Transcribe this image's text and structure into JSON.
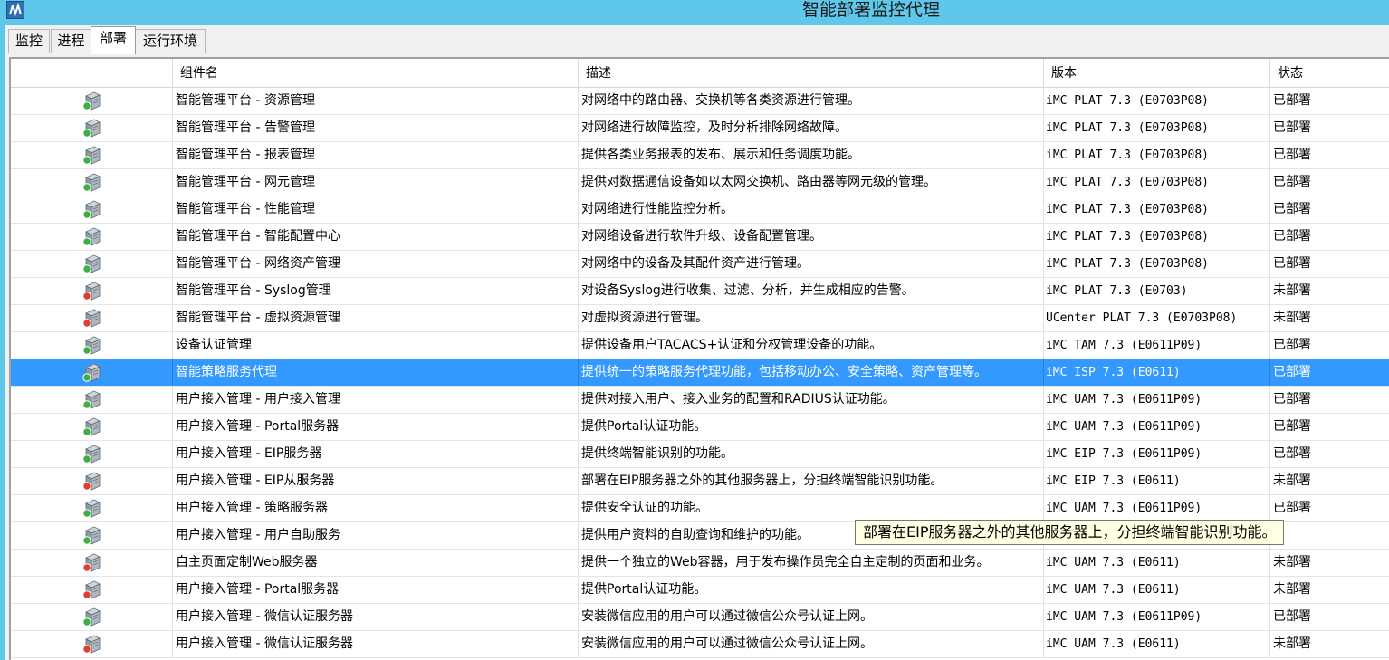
{
  "window": {
    "title": "智能部署监控代理",
    "app_icon": "imc-logo-icon"
  },
  "tabs": [
    {
      "label": "监控",
      "active": false
    },
    {
      "label": "进程",
      "active": false
    },
    {
      "label": "部署",
      "active": true
    },
    {
      "label": "运行环境",
      "active": false
    }
  ],
  "table": {
    "columns": [
      "",
      "组件名",
      "描述",
      "版本",
      "状态"
    ],
    "rows": [
      {
        "status_icon": "deployed-server-icon",
        "name": "智能管理平台 - 资源管理",
        "desc": "对网络中的路由器、交换机等各类资源进行管理。",
        "version": "iMC PLAT 7.3 (E0703P08)",
        "status": "已部署"
      },
      {
        "status_icon": "deployed-server-icon",
        "name": "智能管理平台 - 告警管理",
        "desc": "对网络进行故障监控，及时分析排除网络故障。",
        "version": "iMC PLAT 7.3 (E0703P08)",
        "status": "已部署"
      },
      {
        "status_icon": "deployed-server-icon",
        "name": "智能管理平台 - 报表管理",
        "desc": "提供各类业务报表的发布、展示和任务调度功能。",
        "version": "iMC PLAT 7.3 (E0703P08)",
        "status": "已部署"
      },
      {
        "status_icon": "deployed-server-icon",
        "name": "智能管理平台 - 网元管理",
        "desc": "提供对数据通信设备如以太网交换机、路由器等网元级的管理。",
        "version": "iMC PLAT 7.3 (E0703P08)",
        "status": "已部署"
      },
      {
        "status_icon": "deployed-server-icon",
        "name": "智能管理平台 - 性能管理",
        "desc": "对网络进行性能监控分析。",
        "version": "iMC PLAT 7.3 (E0703P08)",
        "status": "已部署"
      },
      {
        "status_icon": "deployed-server-icon",
        "name": "智能管理平台 - 智能配置中心",
        "desc": "对网络设备进行软件升级、设备配置管理。",
        "version": "iMC PLAT 7.3 (E0703P08)",
        "status": "已部署"
      },
      {
        "status_icon": "deployed-server-icon",
        "name": "智能管理平台 - 网络资产管理",
        "desc": "对网络中的设备及其配件资产进行管理。",
        "version": "iMC PLAT 7.3 (E0703P08)",
        "status": "已部署"
      },
      {
        "status_icon": "undeployed-server-icon",
        "name": "智能管理平台 - Syslog管理",
        "desc": "对设备Syslog进行收集、过滤、分析，并生成相应的告警。",
        "version": "iMC PLAT 7.3 (E0703)",
        "status": "未部署"
      },
      {
        "status_icon": "undeployed-server-icon",
        "name": "智能管理平台 - 虚拟资源管理",
        "desc": "对虚拟资源进行管理。",
        "version": "UCenter PLAT 7.3 (E0703P08)",
        "status": "未部署"
      },
      {
        "status_icon": "deployed-server-icon",
        "name": "设备认证管理",
        "desc": "提供设备用户TACACS+认证和分权管理设备的功能。",
        "version": "iMC TAM 7.3 (E0611P09)",
        "status": "已部署"
      },
      {
        "status_icon": "deployed-server-icon",
        "name": "智能策略服务代理",
        "desc": "提供统一的策略服务代理功能，包括移动办公、安全策略、资产管理等。",
        "version": "iMC ISP 7.3 (E0611)",
        "status": "已部署",
        "selected": true
      },
      {
        "status_icon": "deployed-server-icon",
        "name": "用户接入管理 - 用户接入管理",
        "desc": "提供对接入用户、接入业务的配置和RADIUS认证功能。",
        "version": "iMC UAM 7.3 (E0611P09)",
        "status": "已部署"
      },
      {
        "status_icon": "deployed-server-icon",
        "name": "用户接入管理 - Portal服务器",
        "desc": "提供Portal认证功能。",
        "version": "iMC UAM 7.3 (E0611P09)",
        "status": "已部署"
      },
      {
        "status_icon": "deployed-server-icon",
        "name": "用户接入管理 - EIP服务器",
        "desc": "提供终端智能识别的功能。",
        "version": "iMC EIP 7.3 (E0611P09)",
        "status": "已部署"
      },
      {
        "status_icon": "undeployed-server-icon",
        "name": "用户接入管理 - EIP从服务器",
        "desc": "部署在EIP服务器之外的其他服务器上，分担终端智能识别功能。",
        "version": "iMC EIP 7.3 (E0611)",
        "status": "未部署"
      },
      {
        "status_icon": "deployed-server-icon",
        "name": "用户接入管理 - 策略服务器",
        "desc": "提供安全认证的功能。",
        "version": "iMC UAM 7.3 (E0611P09)",
        "status": "已部署"
      },
      {
        "status_icon": "deployed-server-icon",
        "name": "用户接入管理 - 用户自助服务",
        "desc": "提供用户资料的自助查询和维护的功能。",
        "version": "",
        "status": ""
      },
      {
        "status_icon": "undeployed-server-icon",
        "name": "自主页面定制Web服务器",
        "desc": "提供一个独立的Web容器，用于发布操作员完全自主定制的页面和业务。",
        "version": "iMC UAM 7.3 (E0611)",
        "status": "未部署"
      },
      {
        "status_icon": "undeployed-server-icon",
        "name": "用户接入管理 - Portal服务器",
        "desc": "提供Portal认证功能。",
        "version": "iMC UAM 7.3 (E0611)",
        "status": "未部署"
      },
      {
        "status_icon": "deployed-server-icon",
        "name": "用户接入管理 - 微信认证服务器",
        "desc": "安装微信应用的用户可以通过微信公众号认证上网。",
        "version": "iMC UAM 7.3 (E0611P09)",
        "status": "已部署"
      },
      {
        "status_icon": "undeployed-server-icon",
        "name": "用户接入管理 - 微信认证服务器",
        "desc": "安装微信应用的用户可以通过微信公众号认证上网。",
        "version": "iMC UAM 7.3 (E0611)",
        "status": "未部署"
      }
    ]
  },
  "tooltip": {
    "text": "部署在EIP服务器之外的其他服务器上，分担终端智能识别功能。"
  },
  "colors": {
    "titlebar": "#5fc7ea",
    "selection": "#3399ff",
    "deployed": "#3cb043",
    "undeployed": "#e03c31",
    "tooltip_bg": "#ffffe1"
  }
}
